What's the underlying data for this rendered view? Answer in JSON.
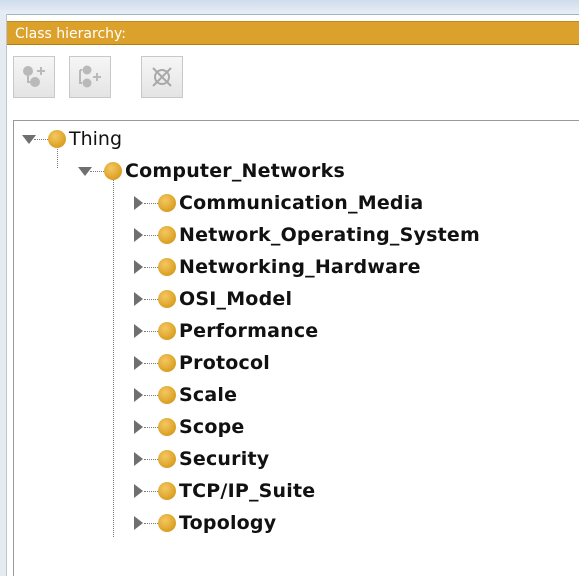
{
  "panel": {
    "title": "Class hierarchy:"
  },
  "toolbar": {
    "buttons": [
      {
        "name": "add-subclass",
        "icon": "add-subclass-icon",
        "enabled": false
      },
      {
        "name": "add-sibling",
        "icon": "add-sibling-class-icon",
        "enabled": false
      },
      {
        "name": "delete-class",
        "icon": "delete-class-icon",
        "enabled": false
      }
    ]
  },
  "colors": {
    "title_bar": "#dca12a",
    "class_dot": "#dfa52b",
    "expander": "#6f6f6f"
  },
  "tree": {
    "root": {
      "label": "Thing",
      "expanded": true,
      "icon": "class-dot-icon",
      "children": [
        {
          "label": "Computer_Networks",
          "expanded": true,
          "icon": "class-dot-icon",
          "children": [
            {
              "label": "Communication_Media",
              "expanded": false
            },
            {
              "label": "Network_Operating_System",
              "expanded": false
            },
            {
              "label": "Networking_Hardware",
              "expanded": false
            },
            {
              "label": "OSI_Model",
              "expanded": false
            },
            {
              "label": "Performance",
              "expanded": false
            },
            {
              "label": "Protocol",
              "expanded": false
            },
            {
              "label": "Scale",
              "expanded": false
            },
            {
              "label": "Scope",
              "expanded": false
            },
            {
              "label": "Security",
              "expanded": false
            },
            {
              "label": "TCP/IP_Suite",
              "expanded": false
            },
            {
              "label": "Topology",
              "expanded": false
            }
          ]
        }
      ]
    }
  }
}
